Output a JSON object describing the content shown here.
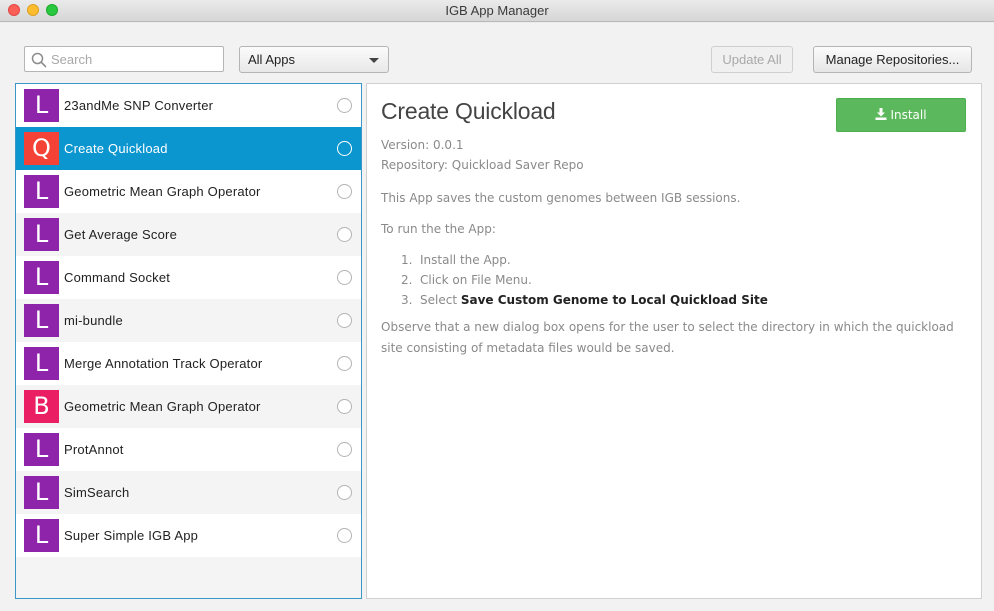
{
  "window": {
    "title": "IGB App Manager"
  },
  "toolbar": {
    "search_placeholder": "Search",
    "filter_selected": "All Apps",
    "update_all_label": "Update All",
    "manage_repos_label": "Manage Repositories..."
  },
  "apps": [
    {
      "letter": "L",
      "name": "23andMe SNP Converter",
      "color": "#8e24aa"
    },
    {
      "letter": "Q",
      "name": "Create Quickload",
      "color": "#f44336"
    },
    {
      "letter": "L",
      "name": "Geometric Mean Graph Operator",
      "color": "#8e24aa"
    },
    {
      "letter": "L",
      "name": "Get Average Score",
      "color": "#8e24aa"
    },
    {
      "letter": "L",
      "name": "Command Socket",
      "color": "#8e24aa"
    },
    {
      "letter": "L",
      "name": "mi-bundle",
      "color": "#8e24aa"
    },
    {
      "letter": "L",
      "name": "Merge Annotation Track Operator",
      "color": "#8e24aa"
    },
    {
      "letter": "B",
      "name": "Geometric Mean Graph Operator",
      "color": "#e91e63"
    },
    {
      "letter": "L",
      "name": "ProtAnnot",
      "color": "#8e24aa"
    },
    {
      "letter": "L",
      "name": "SimSearch",
      "color": "#8e24aa"
    },
    {
      "letter": "L",
      "name": "Super Simple IGB App",
      "color": "#8e24aa"
    }
  ],
  "selected_index": 1,
  "detail": {
    "title": "Create Quickload",
    "install_label": "Install",
    "version": "Version: 0.0.1",
    "repository": "Repository: Quickload Saver Repo",
    "description": "This App saves the custom genomes between IGB sessions.",
    "howto": "To run the the App:",
    "steps": [
      {
        "num": "1.",
        "text": "Install the App.",
        "bold": ""
      },
      {
        "num": "2.",
        "text": "Click on File Menu.",
        "bold": ""
      },
      {
        "num": "3.",
        "text": "Select ",
        "bold": "Save Custom Genome to Local Quickload Site"
      }
    ],
    "observe": "Observe that a new dialog box opens for the user to select the directory in which the quickload site consisting of metadata files would be saved."
  }
}
